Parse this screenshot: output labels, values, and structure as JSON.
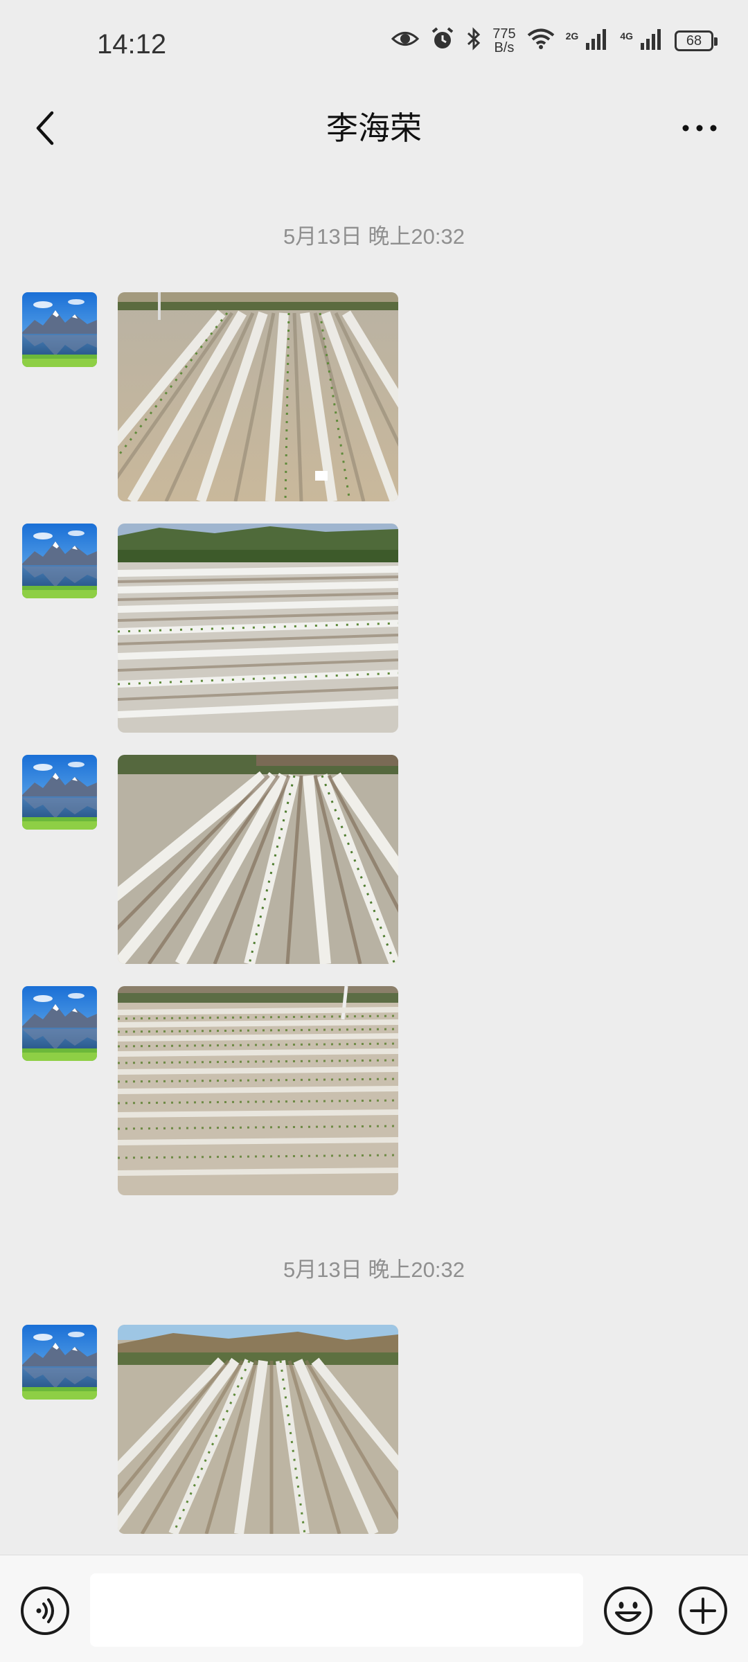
{
  "status_bar": {
    "time": "14:12",
    "net_speed_value": "775",
    "net_speed_unit": "B/s",
    "sig1_tag": "2G",
    "sig2_tag": "4G",
    "battery": "68",
    "icons": [
      "eye-icon",
      "alarm-icon",
      "bluetooth-icon",
      "wifi-icon",
      "signal-icon",
      "battery-icon"
    ]
  },
  "nav": {
    "title": "李海荣",
    "back_icon": "chevron-left-icon",
    "more_icon": "more-dots-icon"
  },
  "chat": {
    "timestamps": [
      "5月13日 晚上20:32",
      "5月13日 晚上20:32"
    ],
    "messages": [
      {
        "sender": "李海荣",
        "type": "image",
        "content": "plastic-mulch-field-photo"
      },
      {
        "sender": "李海荣",
        "type": "image",
        "content": "plastic-mulch-field-photo"
      },
      {
        "sender": "李海荣",
        "type": "image",
        "content": "plastic-mulch-field-photo"
      },
      {
        "sender": "李海荣",
        "type": "image",
        "content": "plastic-mulch-field-photo"
      },
      {
        "sender": "李海荣",
        "type": "image",
        "content": "plastic-mulch-field-photo"
      }
    ]
  },
  "input_bar": {
    "input_value": "",
    "input_placeholder": "",
    "icons": [
      "voice-icon",
      "emoji-icon",
      "plus-icon"
    ]
  },
  "colors": {
    "background": "#ededed",
    "input_bar_bg": "#f7f7f7",
    "timestamp_text": "#8f8f8f"
  }
}
